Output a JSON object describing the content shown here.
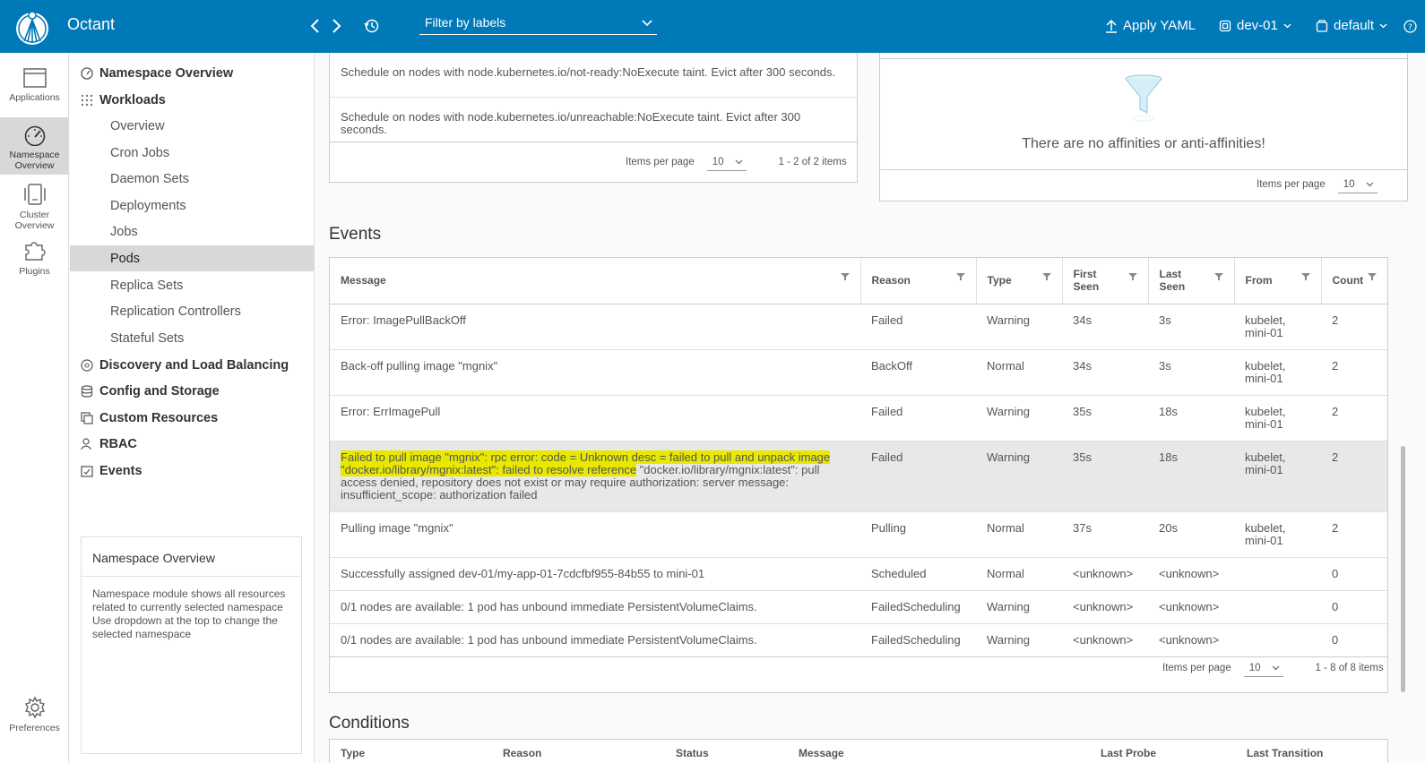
{
  "header": {
    "app_title": "Octant",
    "filter_placeholder": "Filter by labels",
    "apply_yaml": "Apply YAML",
    "context": "dev-01",
    "namespace": "default"
  },
  "rail": [
    {
      "label": "Applications",
      "icon": "browser-window-icon"
    },
    {
      "label": "Namespace Overview",
      "icon": "dashboard-gauge-icon",
      "active": true
    },
    {
      "label": "Cluster Overview",
      "icon": "cluster-icon"
    },
    {
      "label": "Plugins",
      "icon": "puzzle-icon"
    },
    {
      "label": "Preferences",
      "icon": "gear-icon"
    }
  ],
  "sidenav": {
    "items": [
      {
        "label": "Namespace Overview",
        "level": "top",
        "icon": "gauge-icon"
      },
      {
        "label": "Workloads",
        "level": "top",
        "icon": "grid-icon"
      },
      {
        "label": "Overview",
        "level": "sub"
      },
      {
        "label": "Cron Jobs",
        "level": "sub"
      },
      {
        "label": "Daemon Sets",
        "level": "sub"
      },
      {
        "label": "Deployments",
        "level": "sub"
      },
      {
        "label": "Jobs",
        "level": "sub"
      },
      {
        "label": "Pods",
        "level": "sub",
        "selected": true
      },
      {
        "label": "Replica Sets",
        "level": "sub"
      },
      {
        "label": "Replication Controllers",
        "level": "sub"
      },
      {
        "label": "Stateful Sets",
        "level": "sub"
      },
      {
        "label": "Discovery and Load Balancing",
        "level": "top",
        "icon": "network-icon"
      },
      {
        "label": "Config and Storage",
        "level": "top",
        "icon": "storage-icon"
      },
      {
        "label": "Custom Resources",
        "level": "top",
        "icon": "stack-icon"
      },
      {
        "label": "RBAC",
        "level": "top",
        "icon": "user-key-icon"
      },
      {
        "label": "Events",
        "level": "top",
        "icon": "calendar-check-icon"
      }
    ],
    "help_title": "Namespace Overview",
    "help_body": "Namespace module shows all resources related to currently selected namespace Use dropdown at the top to change the selected namespace"
  },
  "tolerations": {
    "rows": [
      "Schedule on nodes with node.kubernetes.io/not-ready:NoExecute taint. Evict after 300 seconds.",
      "Schedule on nodes with node.kubernetes.io/unreachable:NoExecute taint. Evict after 300 seconds."
    ],
    "items_per_page_label": "Items per page",
    "page_size": "10",
    "range": "1 - 2 of 2 items"
  },
  "affinities": {
    "empty_message": "There are no affinities or anti-affinities!",
    "items_per_page_label": "Items per page",
    "page_size": "10"
  },
  "events": {
    "title": "Events",
    "columns": [
      "Message",
      "Reason",
      "Type",
      "First Seen",
      "Last Seen",
      "From",
      "Count"
    ],
    "rows": [
      {
        "message": "Error: ImagePullBackOff",
        "reason": "Failed",
        "type": "Warning",
        "first": "34s",
        "last": "3s",
        "from": "kubelet, mini-01",
        "count": "2"
      },
      {
        "message": "Back-off pulling image \"mgnix\"",
        "reason": "BackOff",
        "type": "Normal",
        "first": "34s",
        "last": "3s",
        "from": "kubelet, mini-01",
        "count": "2"
      },
      {
        "message": "Error: ErrImagePull",
        "reason": "Failed",
        "type": "Warning",
        "first": "35s",
        "last": "18s",
        "from": "kubelet, mini-01",
        "count": "2"
      },
      {
        "message_highlight": "Failed to pull image \"mgnix\": rpc error: code = Unknown desc = failed to pull and unpack image \"docker.io/library/mgnix:latest\": failed to resolve reference",
        "message_rest": "\"docker.io/library/mgnix:latest\": pull access denied, repository does not exist or may require authorization: server message: insufficient_scope: authorization failed",
        "reason": "Failed",
        "type": "Warning",
        "first": "35s",
        "last": "18s",
        "from": "kubelet, mini-01",
        "count": "2",
        "highlighted": true
      },
      {
        "message": "Pulling image \"mgnix\"",
        "reason": "Pulling",
        "type": "Normal",
        "first": "37s",
        "last": "20s",
        "from": "kubelet, mini-01",
        "count": "2"
      },
      {
        "message": "Successfully assigned dev-01/my-app-01-7cdcfbf955-84b55 to mini-01",
        "reason": "Scheduled",
        "type": "Normal",
        "first": "<unknown>",
        "last": "<unknown>",
        "from": "",
        "count": "0"
      },
      {
        "message": "0/1 nodes are available: 1 pod has unbound immediate PersistentVolumeClaims.",
        "reason": "FailedScheduling",
        "type": "Warning",
        "first": "<unknown>",
        "last": "<unknown>",
        "from": "",
        "count": "0"
      },
      {
        "message": "0/1 nodes are available: 1 pod has unbound immediate PersistentVolumeClaims.",
        "reason": "FailedScheduling",
        "type": "Warning",
        "first": "<unknown>",
        "last": "<unknown>",
        "from": "",
        "count": "0"
      }
    ],
    "items_per_page_label": "Items per page",
    "page_size": "10",
    "range": "1 - 8 of 8 items"
  },
  "conditions": {
    "title": "Conditions",
    "columns": [
      "Type",
      "Reason",
      "Status",
      "Message",
      "Last Probe",
      "Last Transition"
    ]
  },
  "colors": {
    "header": "#0079b8",
    "highlight": "#e8e800",
    "selected": "#d8d8d8"
  }
}
